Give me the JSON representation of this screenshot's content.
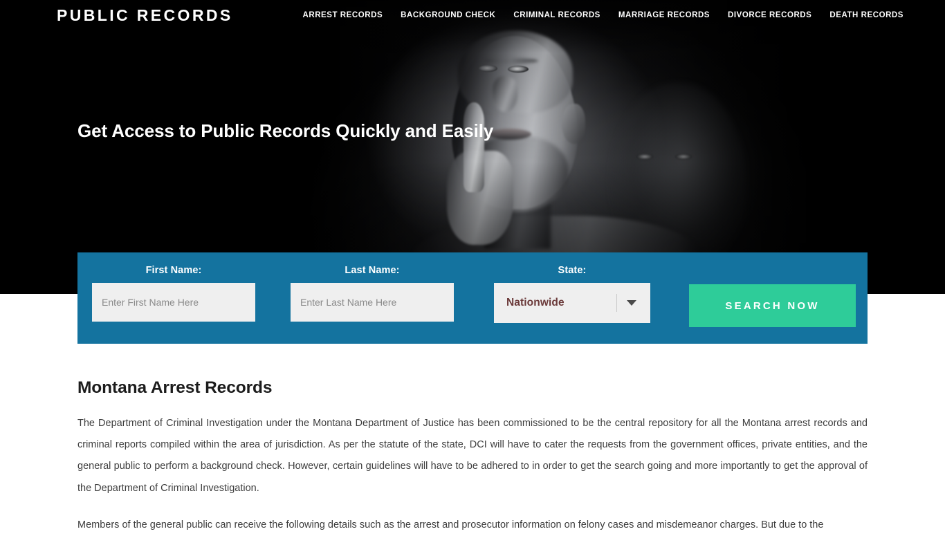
{
  "header": {
    "brand": "PUBLIC RECORDS",
    "nav_items": [
      {
        "label": "ARREST RECORDS"
      },
      {
        "label": "BACKGROUND CHECK"
      },
      {
        "label": "CRIMINAL RECORDS"
      },
      {
        "label": "MARRIAGE RECORDS"
      },
      {
        "label": "DIVORCE RECORDS"
      },
      {
        "label": "DEATH RECORDS"
      }
    ]
  },
  "hero": {
    "title": "Get Access to Public Records Quickly and Easily",
    "background_color": "#000000",
    "image_description": "black and white portrait of a man with finger to lips making a shh gesture"
  },
  "search_form": {
    "band_color": "#14739f",
    "first_name": {
      "label": "First Name:",
      "placeholder": "Enter First Name Here",
      "value": ""
    },
    "last_name": {
      "label": "Last Name:",
      "placeholder": "Enter Last Name Here",
      "value": ""
    },
    "state": {
      "label": "State:",
      "selected": "Nationwide",
      "caret_icon": "chevron-down-icon"
    },
    "submit": {
      "label": "SEARCH NOW",
      "color": "#2ecc99"
    }
  },
  "content": {
    "title": "Montana Arrest Records",
    "paragraphs": [
      "The Department of Criminal Investigation under the Montana Department of Justice has been commissioned to be the central repository for all the Montana arrest records and criminal reports compiled within the area of jurisdiction. As per the statute of the state, DCI will have to cater the requests from the government offices, private entities, and the general public to perform a background check. However, certain guidelines will have to be adhered to in order to get the search going and more importantly to get the approval of the Department of Criminal Investigation.",
      "Members of the general public can receive the following details such as the arrest and prosecutor information on felony cases and misdemeanor charges. But due to the"
    ]
  }
}
